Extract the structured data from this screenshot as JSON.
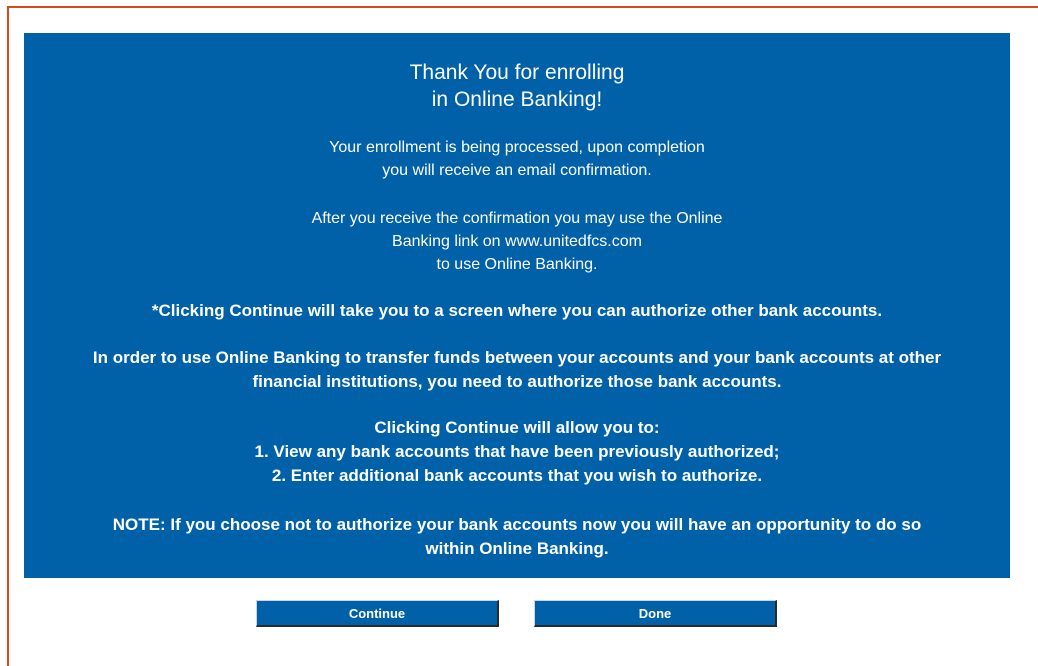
{
  "title": {
    "line1": "Thank You for enrolling",
    "line2": "in Online Banking!"
  },
  "processing": {
    "line1": "Your enrollment is being processed, upon completion",
    "line2": "you will receive an email confirmation."
  },
  "after_confirmation": {
    "line1": "After you receive the confirmation you may use the Online",
    "line2": "Banking link on www.unitedfcs.com",
    "line3": "to use Online Banking."
  },
  "continue_note": "*Clicking Continue will take you to a screen where you can authorize other bank accounts.",
  "transfer_note": {
    "line1": "In order to use Online Banking to transfer funds between your accounts and your bank accounts at other",
    "line2": "financial institutions, you need to authorize those bank accounts."
  },
  "continue_allows": {
    "heading": "Clicking Continue will allow you to:",
    "item1": "1. View any bank accounts that have been previously authorized;",
    "item2": "2. Enter additional bank accounts that you wish to authorize."
  },
  "note": {
    "line1": "NOTE: If you choose not to authorize your bank accounts now you will have an opportunity to do so",
    "line2": "within Online Banking."
  },
  "buttons": {
    "continue_label": "Continue",
    "done_label": "Done"
  },
  "colors": {
    "panel": "#0061a8",
    "frame_border": "#d9481f",
    "text": "#ffffff"
  }
}
